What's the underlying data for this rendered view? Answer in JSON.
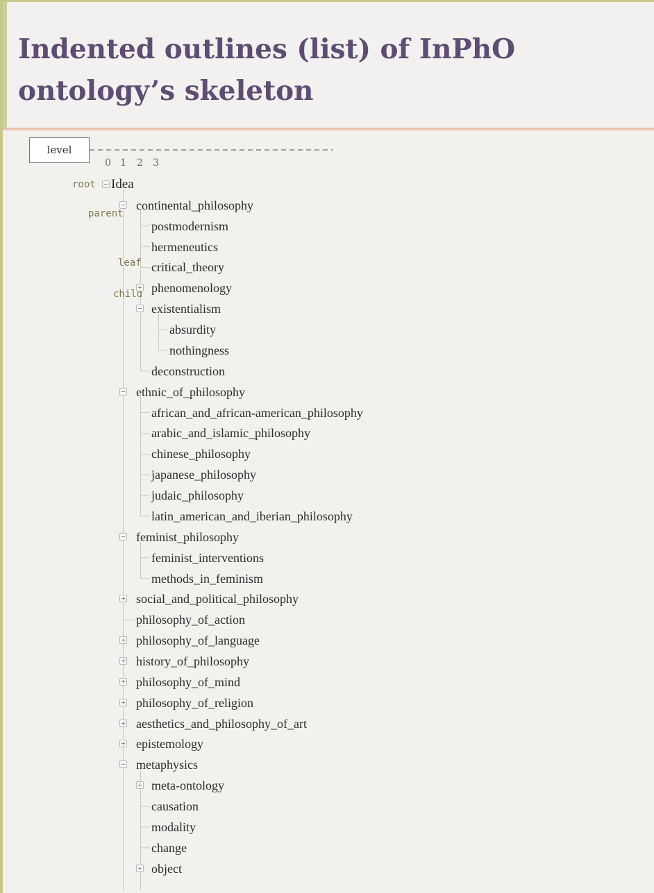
{
  "title": "Indented outlines (list) of InPhO ontology’s skeleton",
  "level_box": "level",
  "level_numbers": [
    "0",
    "1",
    "2",
    "3"
  ],
  "annotations": {
    "root": "root",
    "parent": "parent",
    "leaf": "leaf",
    "child": "child"
  },
  "tree": {
    "root": "Idea",
    "level1": [
      {
        "label": "continental_philosophy",
        "state": "expanded",
        "children": [
          {
            "label": "postmodernism"
          },
          {
            "label": "hermeneutics"
          },
          {
            "label": "critical_theory"
          },
          {
            "label": "phenomenology",
            "state": "collapsed"
          },
          {
            "label": "existentialism",
            "state": "expanded",
            "children": [
              {
                "label": "absurdity"
              },
              {
                "label": "nothingness"
              }
            ]
          },
          {
            "label": "deconstruction"
          }
        ]
      },
      {
        "label": "ethnic_of_philosophy",
        "state": "expanded",
        "children": [
          {
            "label": "african_and_african-american_philosophy"
          },
          {
            "label": "arabic_and_islamic_philosophy"
          },
          {
            "label": "chinese_philosophy"
          },
          {
            "label": "japanese_philosophy"
          },
          {
            "label": "judaic_philosophy"
          },
          {
            "label": "latin_american_and_iberian_philosophy"
          }
        ]
      },
      {
        "label": "feminist_philosophy",
        "state": "expanded",
        "children": [
          {
            "label": "feminist_interventions"
          },
          {
            "label": "methods_in_feminism"
          }
        ]
      },
      {
        "label": "social_and_political_philosophy",
        "state": "collapsed"
      },
      {
        "label": "philosophy_of_action"
      },
      {
        "label": "philosophy_of_language",
        "state": "collapsed"
      },
      {
        "label": "history_of_philosophy",
        "state": "collapsed"
      },
      {
        "label": "philosophy_of_mind",
        "state": "collapsed"
      },
      {
        "label": "philosophy_of_religion",
        "state": "collapsed"
      },
      {
        "label": "aesthetics_and_philosophy_of_art",
        "state": "collapsed"
      },
      {
        "label": "epistemology",
        "state": "collapsed"
      },
      {
        "label": "metaphysics",
        "state": "expanded",
        "children": [
          {
            "label": "meta-ontology",
            "state": "collapsed"
          },
          {
            "label": "causation"
          },
          {
            "label": "modality"
          },
          {
            "label": "change"
          },
          {
            "label": "object",
            "state": "collapsed"
          }
        ]
      }
    ]
  }
}
